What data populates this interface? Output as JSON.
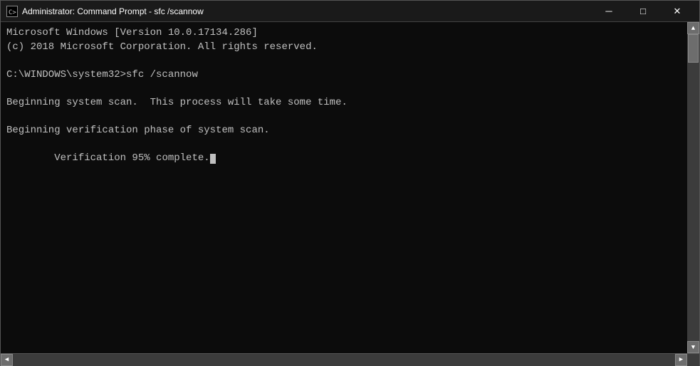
{
  "titleBar": {
    "icon": "cmd-icon",
    "title": "Administrator: Command Prompt - sfc /scannow",
    "minimizeLabel": "─",
    "maximizeLabel": "□",
    "closeLabel": "✕"
  },
  "console": {
    "lines": [
      "Microsoft Windows [Version 10.0.17134.286]",
      "(c) 2018 Microsoft Corporation. All rights reserved.",
      "",
      "C:\\WINDOWS\\system32>sfc /scannow",
      "",
      "Beginning system scan.  This process will take some time.",
      "",
      "Beginning verification phase of system scan.",
      "Verification 95% complete."
    ]
  }
}
